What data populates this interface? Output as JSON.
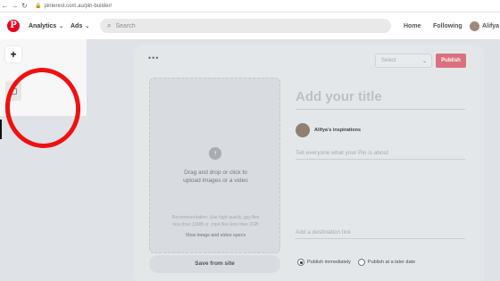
{
  "browser": {
    "url": "pinterest.com.au/pin-builder/"
  },
  "header": {
    "logo": "P",
    "analytics_label": "Analytics",
    "ads_label": "Ads",
    "search_placeholder": "Search",
    "home_label": "Home",
    "following_label": "Following",
    "user_name": "Alifya"
  },
  "sidebar": {
    "add_label": "+"
  },
  "builder": {
    "more_dots": "•••",
    "board_select": "Select",
    "publish_label": "Publish",
    "upload": {
      "drag_text": "Drag and drop or click to\nupload images or a video",
      "recommendation": "Recommendation: Use high-quality .jpg files\nless than 32MB or .mp4 files less than 2GB",
      "specs_link": "View image and video specs"
    },
    "save_from_site": "Save from site",
    "title_placeholder": "Add your title",
    "owner_name": "Alifya's inspirations",
    "description_placeholder": "Tell everyone what your Pin is about",
    "destination_placeholder": "Add a destination link",
    "publish_options": {
      "immediately": "Publish immediately",
      "later": "Publish at a later date"
    }
  },
  "colors": {
    "pinterest_red": "#e60023",
    "annotation_circle": "#ee1111",
    "publish_button": "#d9727e"
  }
}
